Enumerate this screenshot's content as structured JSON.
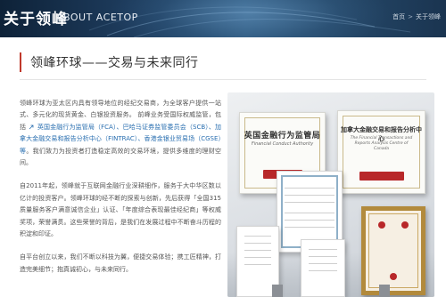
{
  "banner": {
    "title": "关于领峰",
    "subtitle": "ABOUT ACETOP",
    "breadcrumb": [
      "首页",
      "关于领峰"
    ]
  },
  "section": {
    "title": "领峰环球——交易与未来同行"
  },
  "body": {
    "p1_prefix": "领峰环球为亚太区内具有领导地位的经纪交易商，为全球客户提供一站式、多元化的现货黄金、白银投资服务。 前峰业务受国际权威监管，包括",
    "p1_link": "英国金融行为监管局（FCA）、巴哈马证券监管委员会（SCB）、加拿大金融交易和报告分析中心（FINTRAC）、香港金银业贸易场（CGSE）等",
    "p1_suffix": "。我们致力为投资者打造稳定高效的交易环境，提供多维度的理财空间。",
    "p2": "自2011年起，领峰就于互联网金融行业深耕细作，服务于大中华区数以亿计的投资客户。领峰环球的经不断的探索与创新，先后获得「全国315质量服务客户满意诚信企业」认证、「年度综合表现最佳经纪商」等权威奖项，荣誉满贯。这些荣誉的背后，是我们在发展过程中不断奋斗历程的积淀和印证。",
    "p3": "自平台创立以来，我们不断以科技为翼，便捷交易体验；携工匠精神，打造完美细节；抱真诚初心，与未来同行。"
  },
  "awards": {
    "plaque1_title": "英国金融行为监管局",
    "plaque1_sub": "Financial Conduct Authority",
    "plaque2_title": "加拿大金融交易和报告分析中心",
    "plaque2_sub": "The Financial Transactions and Reports Analysis Centre of Canada"
  },
  "colors": {
    "accent": "#c0392b",
    "link": "#2a6fb0",
    "banner_dark": "#0e2238"
  }
}
